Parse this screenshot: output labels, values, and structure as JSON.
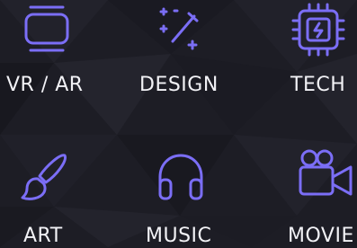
{
  "accent_color": "#7b6ef6",
  "categories": [
    {
      "label": "VR / AR",
      "icon": "vr-headset-icon"
    },
    {
      "label": "DESIGN",
      "icon": "magic-wand-icon"
    },
    {
      "label": "TECH",
      "icon": "cpu-chip-icon"
    },
    {
      "label": "ART",
      "icon": "paint-brush-icon"
    },
    {
      "label": "MUSIC",
      "icon": "headphones-icon"
    },
    {
      "label": "MOVIE",
      "icon": "video-camera-icon"
    }
  ]
}
